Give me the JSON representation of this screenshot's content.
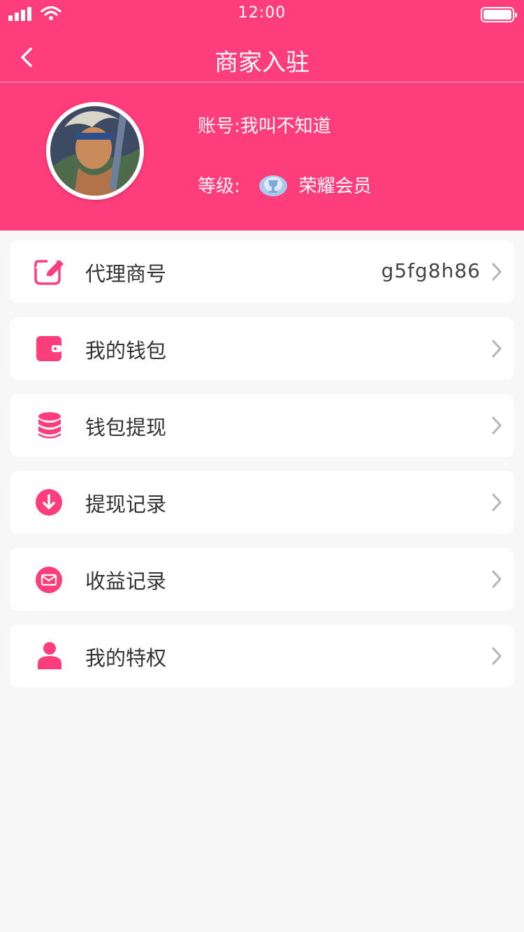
{
  "status_bar": {
    "time": "12:00"
  },
  "nav": {
    "title": "商家入驻",
    "back_icon": "chevron-left-icon"
  },
  "profile": {
    "account_label": "账号:",
    "account_value": "我叫不知道",
    "level_label": "等级:",
    "level_value": "荣耀会员",
    "level_icon": "trophy-badge-icon"
  },
  "colors": {
    "primary": "#fe3e7c",
    "background": "#f7f7f7",
    "text": "#333333",
    "chevron": "#b5b5b5"
  },
  "menu": [
    {
      "label": "代理商号",
      "value": "g5fg8h86",
      "icon": "edit-icon"
    },
    {
      "label": "我的钱包",
      "value": "",
      "icon": "wallet-icon"
    },
    {
      "label": "钱包提现",
      "value": "",
      "icon": "database-icon"
    },
    {
      "label": "提现记录",
      "value": "",
      "icon": "download-circle-icon"
    },
    {
      "label": "收益记录",
      "value": "",
      "icon": "mail-circle-icon"
    },
    {
      "label": "我的特权",
      "value": "",
      "icon": "user-icon"
    }
  ]
}
